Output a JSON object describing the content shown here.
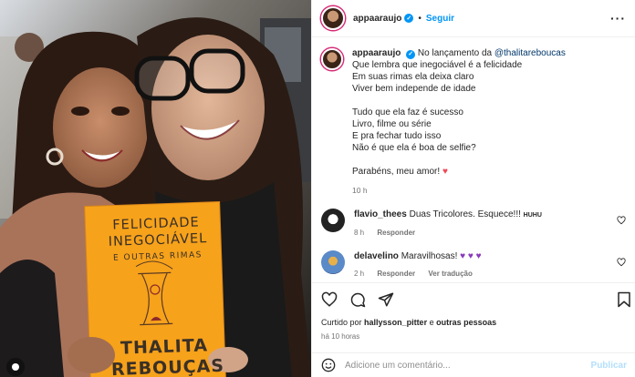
{
  "header": {
    "username": "appaaraujo",
    "follow_label": "Seguir",
    "dot": "•",
    "more_label": "···"
  },
  "caption": {
    "username": "appaaraujo",
    "intro": "No lançamento da",
    "mention": "@thalitareboucas",
    "lines_a": [
      "Que lembra que inegociável é a felicidade",
      "Em suas rimas ela deixa claro",
      "Viver bem independe de idade"
    ],
    "lines_b": [
      "Tudo que ela faz é sucesso",
      "Livro, filme ou série",
      "E pra fechar tudo isso",
      "Não é que ela é boa de selfie?"
    ],
    "closing": "Parabéns, meu amor!",
    "closing_emoji": "♥",
    "time": "10 h"
  },
  "comments": [
    {
      "username": "flavio_thees",
      "text": "Duas Tricolores. Esquece!!!",
      "extra": "HUHU",
      "time": "8 h",
      "reply_label": "Responder"
    },
    {
      "username": "delavelino",
      "text": "Maravilhosas!",
      "emojis": "♥ ♥ ♥",
      "time": "2 h",
      "reply_label": "Responder",
      "translate_label": "Ver tradução"
    }
  ],
  "likes": {
    "prefix": "Curtido por",
    "user": "hallysson_pitter",
    "conj": "e",
    "others": "outras pessoas"
  },
  "post_time": "há 10 horas",
  "comment_box": {
    "placeholder": "Adicione um comentário...",
    "publish_label": "Publicar"
  },
  "book": {
    "title_line1": "FELICIDADE",
    "title_line2": "INEGOCIÁVEL",
    "subtitle": "E OUTRAS RIMAS",
    "author_line1": "THALITA",
    "author_line2": "REBOUÇAS"
  },
  "colors": {
    "link": "#0095f6",
    "mention": "#00376b",
    "heart": "#ed4956",
    "book": "#f7a21b"
  }
}
